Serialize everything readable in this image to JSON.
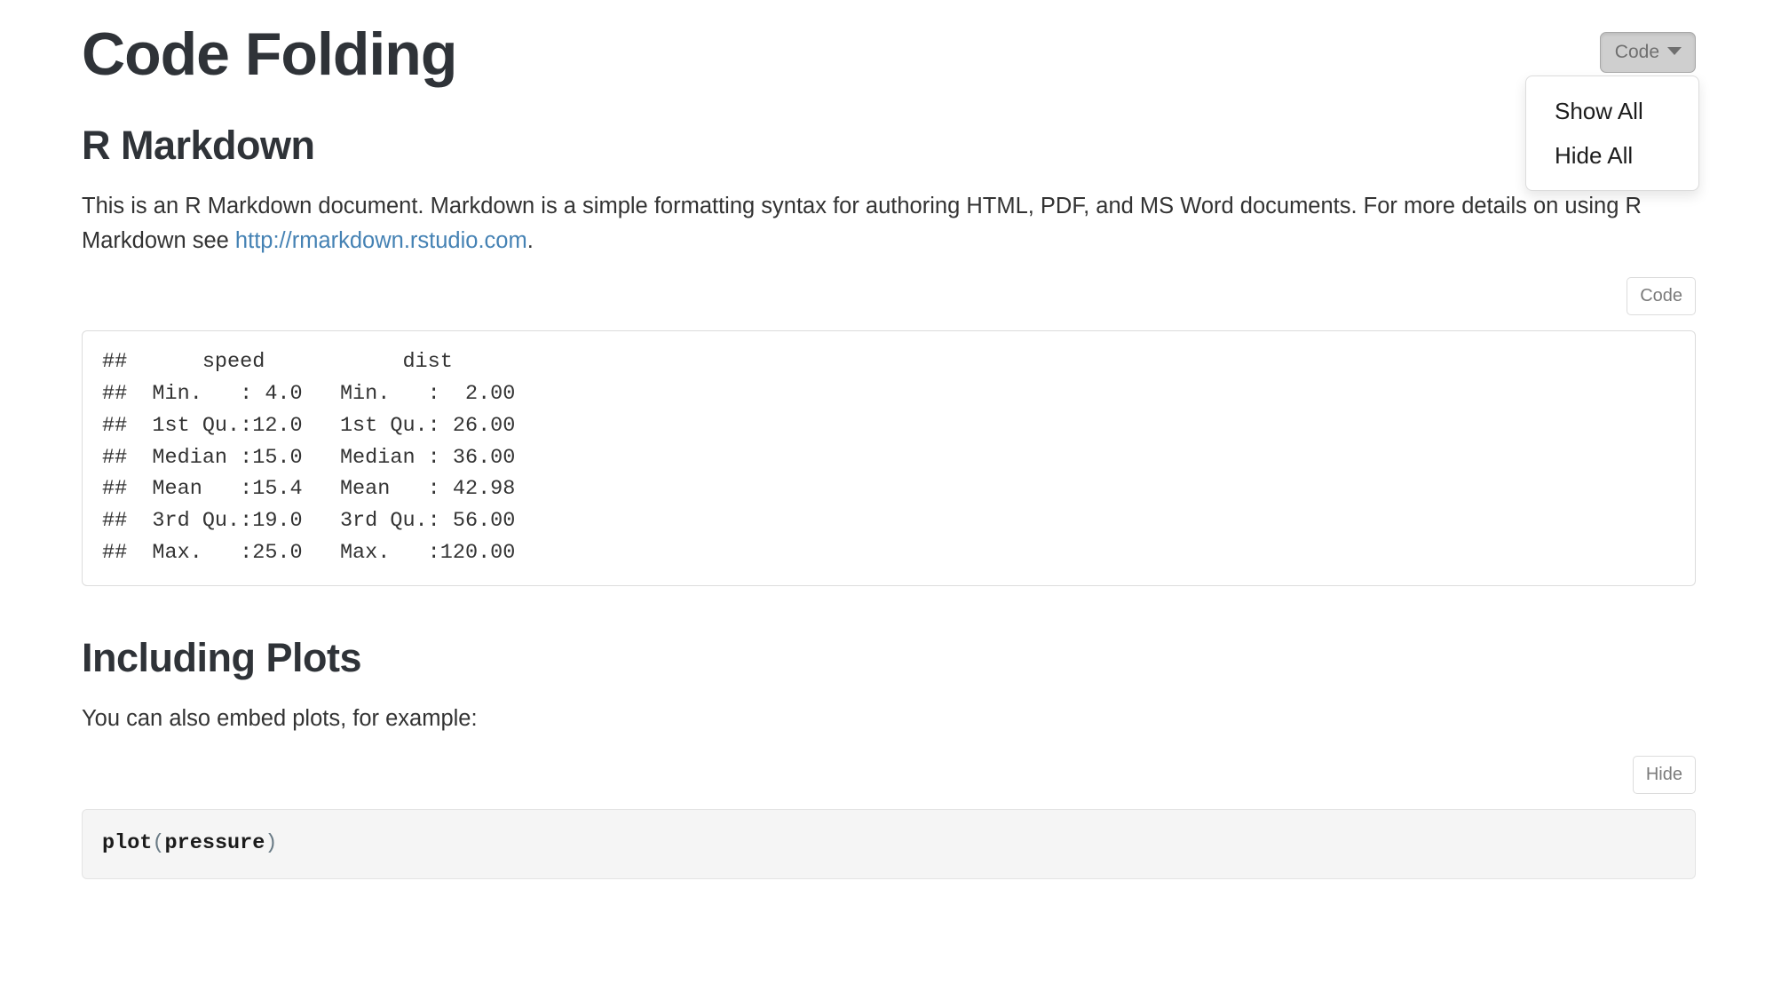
{
  "document": {
    "title": "Code Folding",
    "sections": [
      {
        "heading": "R Markdown",
        "paragraph_before_link": "This is an R Markdown document. Markdown is a simple formatting syntax for authoring HTML, PDF, and MS Word documents. For more details on using R Markdown see ",
        "link_text": "http://rmarkdown.rstudio.com",
        "paragraph_after_link": "."
      },
      {
        "heading": "Including Plots",
        "paragraph": "You can also embed plots, for example:"
      }
    ]
  },
  "toolbar": {
    "dropdown_label": "Code",
    "caret_icon": "chevron-down-icon",
    "menu_items": [
      {
        "label": "Show All"
      },
      {
        "label": "Hide All"
      }
    ]
  },
  "chunks": {
    "summary_cars": {
      "toggle_label": "Code",
      "output": "##      speed           dist\n##  Min.   : 4.0   Min.   :  2.00\n##  1st Qu.:12.0   1st Qu.: 26.00\n##  Median :15.0   Median : 36.00\n##  Mean   :15.4   Mean   : 42.98\n##  3rd Qu.:19.0   3rd Qu.: 56.00\n##  Max.   :25.0   Max.   :120.00"
    },
    "plot_pressure": {
      "toggle_label": "Hide",
      "code_fn": "plot",
      "code_open_paren": "(",
      "code_arg": "pressure",
      "code_close_paren": ")"
    }
  },
  "colors": {
    "link": "#4582b4",
    "heading": "#2f3338",
    "body_text": "#333333",
    "button_border": "#dcdcdc",
    "button_text": "#7b7b7b",
    "dropdown_active_bg": "#cfcfcf",
    "source_block_bg": "#f5f5f5"
  }
}
